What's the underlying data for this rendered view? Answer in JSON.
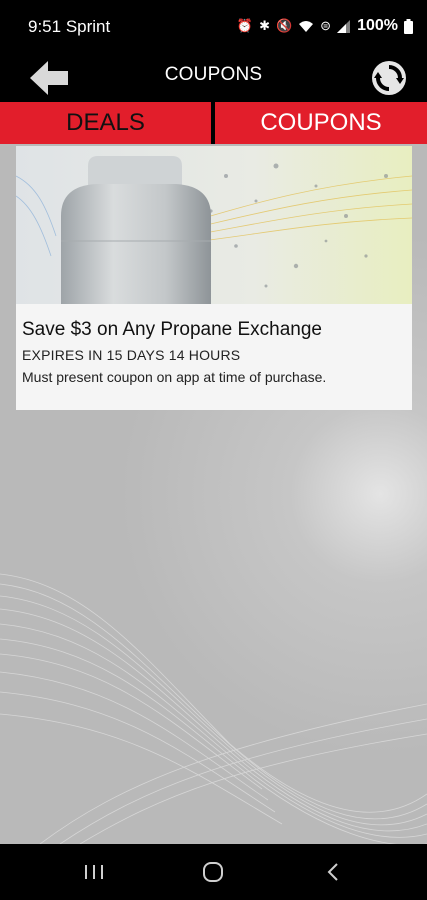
{
  "status_bar": {
    "time": "9:51",
    "carrier": "Sprint",
    "battery": "100%"
  },
  "header": {
    "title": "COUPONS"
  },
  "tabs": [
    {
      "label": "DEALS",
      "active": false
    },
    {
      "label": "COUPONS",
      "active": true
    }
  ],
  "coupons": [
    {
      "title": "Save $3 on Any Propane Exchange",
      "expiry": "EXPIRES IN 15 DAYS 14 HOURS",
      "note": "Must present coupon on app at time of purchase.",
      "image": "propane-tank-image"
    }
  ],
  "nav": {
    "recent": "recent-apps-icon",
    "home": "home-icon",
    "back": "back-icon"
  },
  "colors": {
    "accent": "#e21e2b",
    "bar": "#000000"
  }
}
